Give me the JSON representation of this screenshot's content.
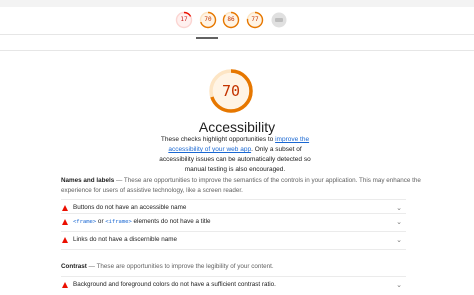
{
  "gauges_nav": [
    {
      "name": "performance",
      "score": "17",
      "color": "#eb0f00"
    },
    {
      "name": "accessibility",
      "score": "70",
      "color": "#e67700"
    },
    {
      "name": "best-practices",
      "score": "86",
      "color": "#e67700"
    },
    {
      "name": "seo",
      "score": "77",
      "color": "#e67700"
    },
    {
      "name": "pwa",
      "score": "",
      "color": "#bdbdbd"
    }
  ],
  "category": {
    "score": "70",
    "score_fraction": 0.7,
    "title": "Accessibility",
    "desc_before": "These checks highlight opportunities to ",
    "desc_link": "improve the accessibility of your web app",
    "desc_after": ". Only a subset of accessibility issues can be automatically detected so manual testing is also encouraged."
  },
  "groups": {
    "names_labels": {
      "title": "Names and labels",
      "desc": " — These are opportunities to improve the semantics of the controls in your application. This may enhance the experience for users of assistive technology, like a screen reader."
    },
    "contrast": {
      "title": "Contrast",
      "desc": " — These are opportunities to improve the legibility of your content."
    }
  },
  "audits": {
    "button_name": "Buttons do not have an accessible name",
    "frame_code1": "<frame>",
    "frame_or": " or ",
    "frame_code2": "<iframe>",
    "frame_rest": " elements do not have a title",
    "link_name": "Links do not have a discernible name",
    "contrast": "Background and foreground colors do not have a sufficient contrast ratio."
  },
  "icons": {
    "fail": "triangle-fail-icon",
    "expand": "chevron-down-icon"
  }
}
